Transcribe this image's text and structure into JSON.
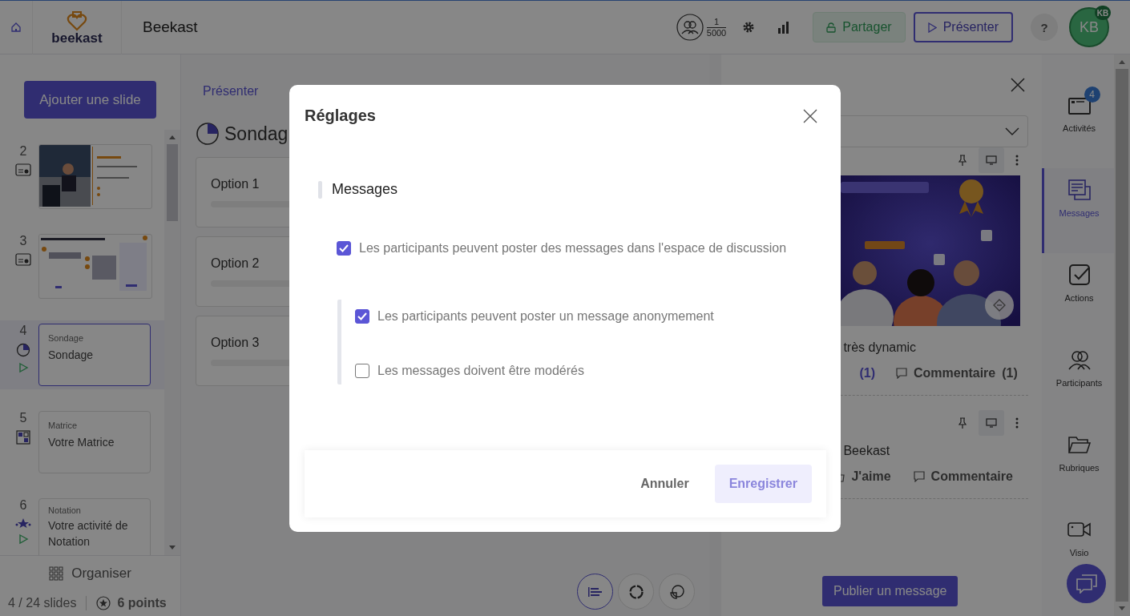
{
  "header": {
    "app_name": "beekast",
    "title": "Beekast",
    "participants": {
      "count": "1",
      "max": "5000"
    },
    "share_button": "Partager",
    "present_button": "Présenter",
    "help": "?",
    "avatar": {
      "initials": "KB",
      "badge": "KB"
    }
  },
  "sidebar": {
    "add_button": "Ajouter une slide",
    "slides": [
      {
        "number": "2",
        "selected": false,
        "playable": false
      },
      {
        "number": "3",
        "selected": false,
        "playable": false
      },
      {
        "number": "4",
        "kind": "poll",
        "type_label": "Sondage",
        "title": "Sondage",
        "selected": true,
        "playable": true
      },
      {
        "number": "5",
        "kind": "matrix",
        "type_label": "Matrice",
        "title": "Votre Matrice",
        "selected": false,
        "playable": false
      },
      {
        "number": "6",
        "kind": "rating",
        "type_label": "Notation",
        "title": "Votre activité de Notation",
        "selected": false,
        "playable": true
      }
    ],
    "organize_button": "Organiser",
    "slide_count": "4 / 24 slides",
    "points": "6 points"
  },
  "center": {
    "tab": "Présenter",
    "title": "Sondag",
    "options": [
      "Option 1",
      "Option 2",
      "Option 3"
    ],
    "view_buttons": [
      {
        "kind": "bars",
        "selected": true
      },
      {
        "kind": "donut",
        "selected": false
      },
      {
        "kind": "pie",
        "selected": false
      }
    ]
  },
  "right_panel": {
    "messages": [
      {
        "kind": "image_post",
        "text": "très dynamic",
        "like_count": "(1)",
        "comment_label": "Commentaire",
        "comment_count": "(1)"
      },
      {
        "kind": "text_post",
        "text": "Beekast",
        "like_label": "J'aime",
        "comment_label": "Commentaire"
      }
    ],
    "publish_button": "Publier un message"
  },
  "rail": [
    {
      "kind": "activities",
      "label": "Activités",
      "badge": "4",
      "selected": false
    },
    {
      "kind": "messages",
      "label": "Messages",
      "selected": true
    },
    {
      "kind": "actions",
      "label": "Actions",
      "selected": false
    },
    {
      "kind": "participants",
      "label": "Participants",
      "selected": false
    },
    {
      "kind": "folders",
      "label": "Rubriques",
      "selected": false
    },
    {
      "kind": "video",
      "label": "Visio",
      "selected": false
    }
  ],
  "modal": {
    "title": "Réglages",
    "section": "Messages",
    "options": [
      {
        "label": "Les participants peuvent poster des messages dans l'espace de discussion",
        "checked": true,
        "children": [
          {
            "label": "Les participants peuvent poster un message anonymement",
            "checked": true
          },
          {
            "label": "Les messages doivent être modérés",
            "checked": false
          }
        ]
      }
    ],
    "cancel_button": "Annuler",
    "save_button": "Enregistrer",
    "save_disabled": true
  }
}
